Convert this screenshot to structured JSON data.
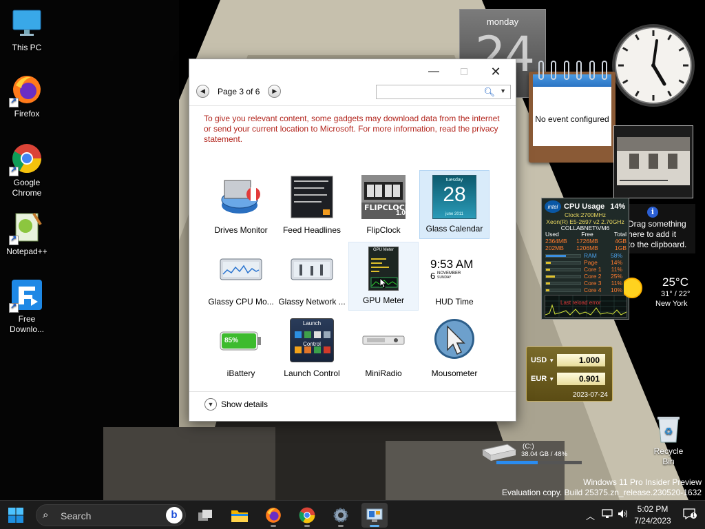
{
  "desktop": {
    "icons": [
      {
        "label": "This PC"
      },
      {
        "label": "Firefox"
      },
      {
        "label": "Google Chrome"
      },
      {
        "label": "Notepad++"
      },
      {
        "label": "Free Downlo..."
      },
      {
        "label": "Recycle Bin"
      }
    ],
    "watermark": {
      "line1": "Windows 11 Pro Insider Preview",
      "line2": "Evaluation copy. Build 25375.zn_release.230520-1632"
    }
  },
  "gadget_window": {
    "pager": {
      "label": "Page 3 of 6",
      "prev_icon": "chevron-left-icon",
      "next_icon": "chevron-right-icon"
    },
    "search": {
      "value": "",
      "placeholder": ""
    },
    "notice": "To give you relevant content, some gadgets may download data from the internet or send your current location to Microsoft. For more information, read the privacy statement.",
    "tiles": [
      {
        "name": "Drives Monitor",
        "state": "normal"
      },
      {
        "name": "Feed Headlines",
        "state": "normal"
      },
      {
        "name": "FlipClock",
        "state": "normal"
      },
      {
        "name": "Glass Calendar",
        "state": "selected"
      },
      {
        "name": "Glassy CPU Mo...",
        "state": "normal"
      },
      {
        "name": "Glassy Network ...",
        "state": "normal"
      },
      {
        "name": "GPU Meter",
        "state": "hovered"
      },
      {
        "name": "HUD Time",
        "state": "normal"
      },
      {
        "name": "iBattery",
        "state": "normal"
      },
      {
        "name": "Launch Control",
        "state": "normal"
      },
      {
        "name": "MiniRadio",
        "state": "normal"
      },
      {
        "name": "Mousometer",
        "state": "normal"
      }
    ],
    "tile_art": {
      "glass_calendar_day": "tuesday",
      "glass_calendar_date": "28",
      "glass_calendar_month": "june 2011",
      "flipclock_brand": "FLIPCLOCK",
      "flipclock_ver": "1.0",
      "hud_time": "9:53 AM",
      "hud_date_num": "6",
      "hud_month": "NOVEMBER",
      "hud_weekday": "SUNDAY",
      "battery_level": "85%",
      "launch_title": "Launch",
      "launch_sub": "Control",
      "gpu_title": "GPU Meter"
    },
    "show_details": "Show details"
  },
  "gadgets": {
    "calendar": {
      "weekday": "monday",
      "day": "24"
    },
    "notes": {
      "message": "No event configured"
    },
    "clipboard": {
      "text_line1": "Drag something",
      "text_line2": "here to add it",
      "text_line3": "to the clipboard."
    },
    "cpu": {
      "title": "CPU Usage",
      "usage": "14%",
      "clock": "Clock:2700MHz",
      "model": "Xeon(R) E5-2697 v2 2.70GHz",
      "host": "COLLABNET\\VM6",
      "mem_headers": [
        "Used",
        "Free",
        "Total"
      ],
      "mem_rows": [
        [
          "2364MB",
          "1726MB",
          "4GB"
        ],
        [
          "202MB",
          "1206MB",
          "1GB"
        ]
      ],
      "meters": [
        {
          "name": "RAM",
          "value": "58%",
          "level": 0.58,
          "color": "#3c8fe0"
        },
        {
          "name": "Page",
          "value": "14%",
          "level": 0.14,
          "color": "#e0c02a"
        },
        {
          "name": "Core 1",
          "value": "11%",
          "level": 0.11,
          "color": "#e0c02a"
        },
        {
          "name": "Core 2",
          "value": "25%",
          "level": 0.25,
          "color": "#e0c02a"
        },
        {
          "name": "Core 3",
          "value": "11%",
          "level": 0.11,
          "color": "#e0c02a"
        },
        {
          "name": "Core 4",
          "value": "10%",
          "level": 0.1,
          "color": "#e0c02a"
        }
      ],
      "graph_label": "Last reload error"
    },
    "weather": {
      "temp": "25°C",
      "range": "31° / 22°",
      "city": "New York"
    },
    "currency": {
      "rows": [
        {
          "code": "USD",
          "value": "1.000"
        },
        {
          "code": "EUR",
          "value": "0.901"
        }
      ],
      "date": "2023-07-24"
    },
    "drive": {
      "label": "(C:)",
      "detail": "38.04 GB / 48%",
      "used_fraction": 0.48
    }
  },
  "taskbar": {
    "search_placeholder": "Search",
    "bing_letter": "b",
    "apps": [
      "start",
      "task-view",
      "file-explorer",
      "firefox",
      "chrome",
      "settings",
      "gadgets"
    ],
    "time": "5:02 PM",
    "date": "7/24/2023",
    "notification_count": "1"
  }
}
